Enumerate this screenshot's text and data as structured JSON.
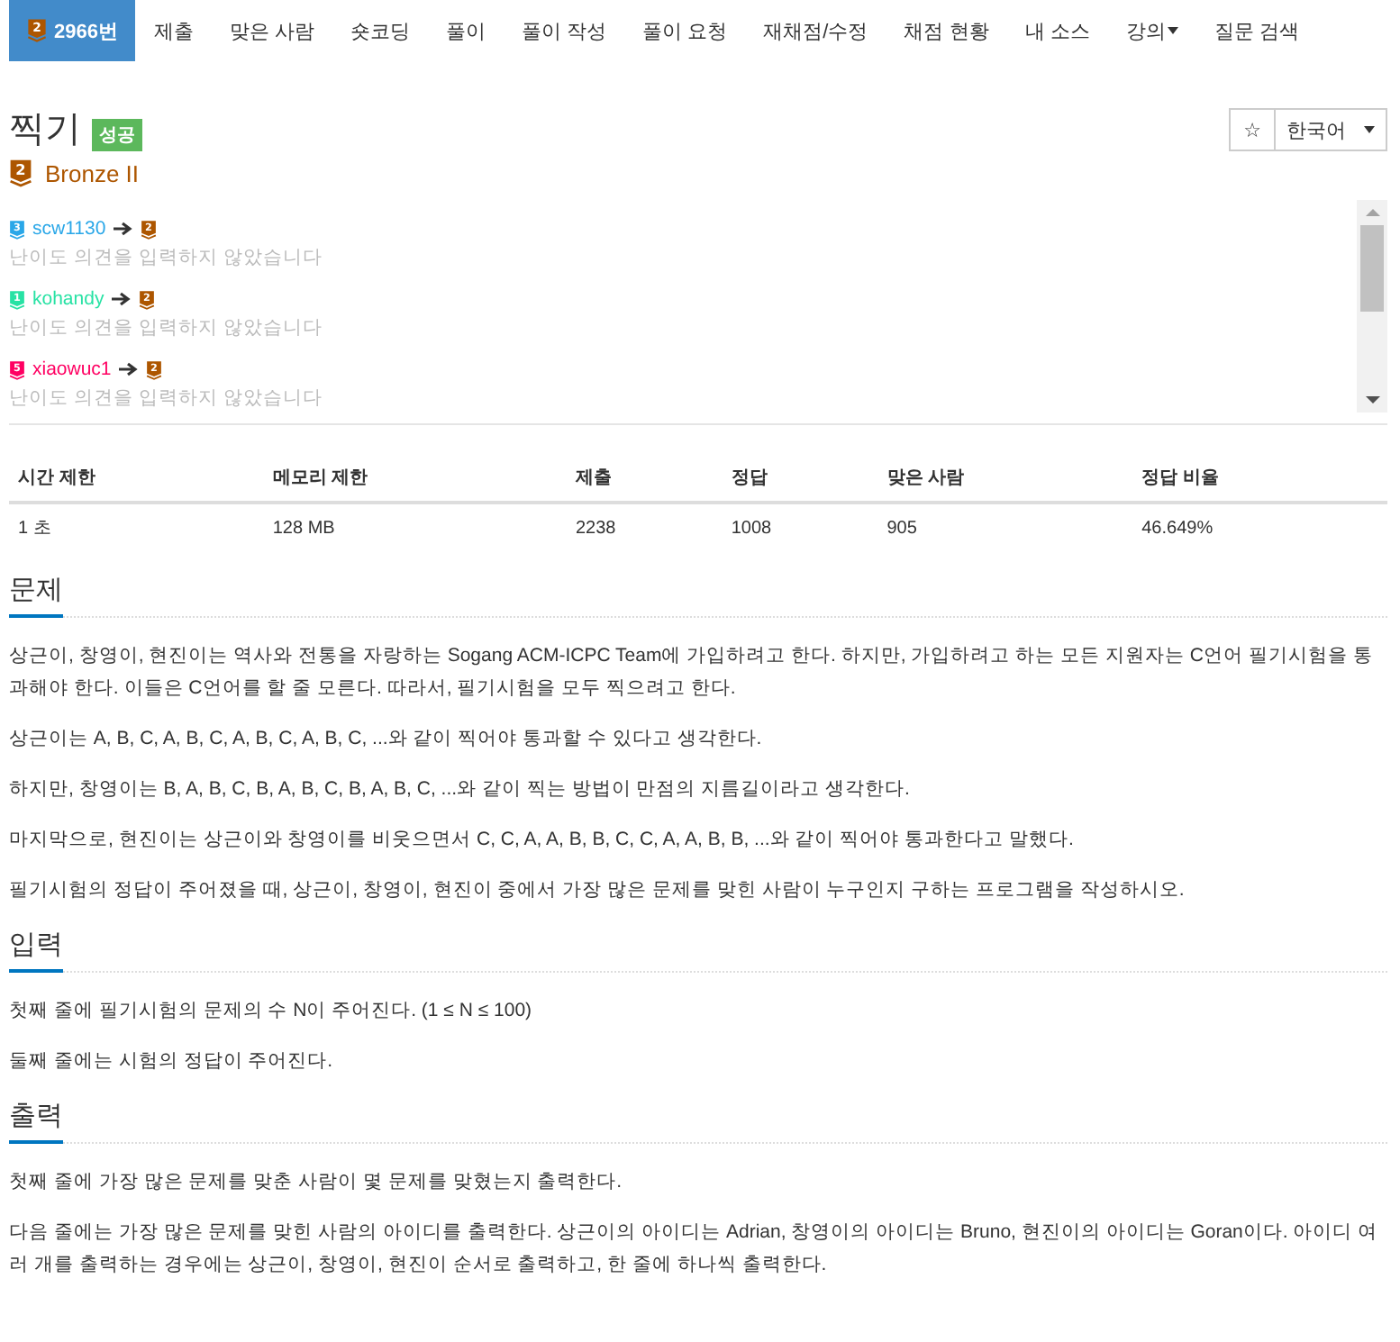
{
  "nav": {
    "tabs": [
      {
        "label": "2966번",
        "selected": true,
        "tier": {
          "text": "2",
          "color": "#ad5600"
        },
        "dropdown": false
      },
      {
        "label": "제출",
        "selected": false,
        "dropdown": false
      },
      {
        "label": "맞은 사람",
        "selected": false,
        "dropdown": false
      },
      {
        "label": "숏코딩",
        "selected": false,
        "dropdown": false
      },
      {
        "label": "풀이",
        "selected": false,
        "dropdown": false
      },
      {
        "label": "풀이 작성",
        "selected": false,
        "dropdown": false
      },
      {
        "label": "풀이 요청",
        "selected": false,
        "dropdown": false
      },
      {
        "label": "재채점/수정",
        "selected": false,
        "dropdown": false
      },
      {
        "label": "채점 현황",
        "selected": false,
        "dropdown": false
      },
      {
        "label": "내 소스",
        "selected": false,
        "dropdown": false
      },
      {
        "label": "강의",
        "selected": false,
        "dropdown": true
      },
      {
        "label": "질문 검색",
        "selected": false,
        "dropdown": false
      }
    ]
  },
  "problem": {
    "title": "찍기",
    "result_label": "성공",
    "star_button": "☆",
    "language": "한국어",
    "tier": {
      "text": "2",
      "color": "#ad5600",
      "name": "Bronze II"
    }
  },
  "opinions": [
    {
      "user": "scw1130",
      "user_tier": {
        "text": "3",
        "color": "#2aa7e8"
      },
      "vote_tier": {
        "text": "2",
        "color": "#ad5600"
      },
      "comment": "난이도 의견을 입력하지 않았습니다"
    },
    {
      "user": "kohandy",
      "user_tier": {
        "text": "1",
        "color": "#27e2a4"
      },
      "vote_tier": {
        "text": "2",
        "color": "#ad5600"
      },
      "comment": "난이도 의견을 입력하지 않았습니다"
    },
    {
      "user": "xiaowuc1",
      "user_tier": {
        "text": "5",
        "color": "#ff0062"
      },
      "vote_tier": {
        "text": "2",
        "color": "#ad5600"
      },
      "comment": "난이도 의견을 입력하지 않았습니다"
    }
  ],
  "stats": {
    "columns": [
      "시간 제한",
      "메모리 제한",
      "제출",
      "정답",
      "맞은 사람",
      "정답 비율"
    ],
    "rows": [
      [
        "1 초",
        "128 MB",
        "2238",
        "1008",
        "905",
        "46.649%"
      ]
    ]
  },
  "sections": [
    {
      "heading": "문제",
      "paragraphs": [
        "상근이, 창영이, 현진이는 역사와 전통을 자랑하는 Sogang ACM-ICPC Team에 가입하려고 한다. 하지만, 가입하려고 하는 모든 지원자는 C언어 필기시험을 통과해야 한다. 이들은 C언어를 할 줄 모른다. 따라서, 필기시험을 모두 찍으려고 한다.",
        "상근이는 A, B, C, A, B, C, A, B, C, A, B, C, ...와 같이 찍어야 통과할 수 있다고 생각한다.",
        "하지만, 창영이는 B, A, B, C, B, A, B, C, B, A, B, C, ...와 같이 찍는 방법이 만점의 지름길이라고 생각한다.",
        "마지막으로, 현진이는 상근이와 창영이를 비웃으면서 C, C, A, A, B, B, C, C, A, A, B, B, ...와 같이 찍어야 통과한다고 말했다.",
        "필기시험의 정답이 주어졌을 때, 상근이, 창영이, 현진이 중에서 가장 많은 문제를 맞힌 사람이 누구인지 구하는 프로그램을 작성하시오."
      ]
    },
    {
      "heading": "입력",
      "paragraphs": [
        "첫째 줄에 필기시험의 문제의 수 N이 주어진다. (1 ≤ N ≤ 100)",
        "둘째 줄에는 시험의 정답이 주어진다."
      ]
    },
    {
      "heading": "출력",
      "paragraphs": [
        "첫째 줄에 가장 많은 문제를 맞춘 사람이 몇 문제를 맞혔는지 출력한다.",
        "다음 줄에는 가장 많은 문제를 맞힌 사람의 아이디를 출력한다. 상근이의 아이디는 Adrian, 창영이의 아이디는 Bruno, 현진이의 아이디는 Goran이다. 아이디 여러 개를 출력하는 경우에는 상근이, 창영이, 현진이 순서로 출력하고, 한 줄에 하나씩 출력한다."
      ]
    }
  ]
}
